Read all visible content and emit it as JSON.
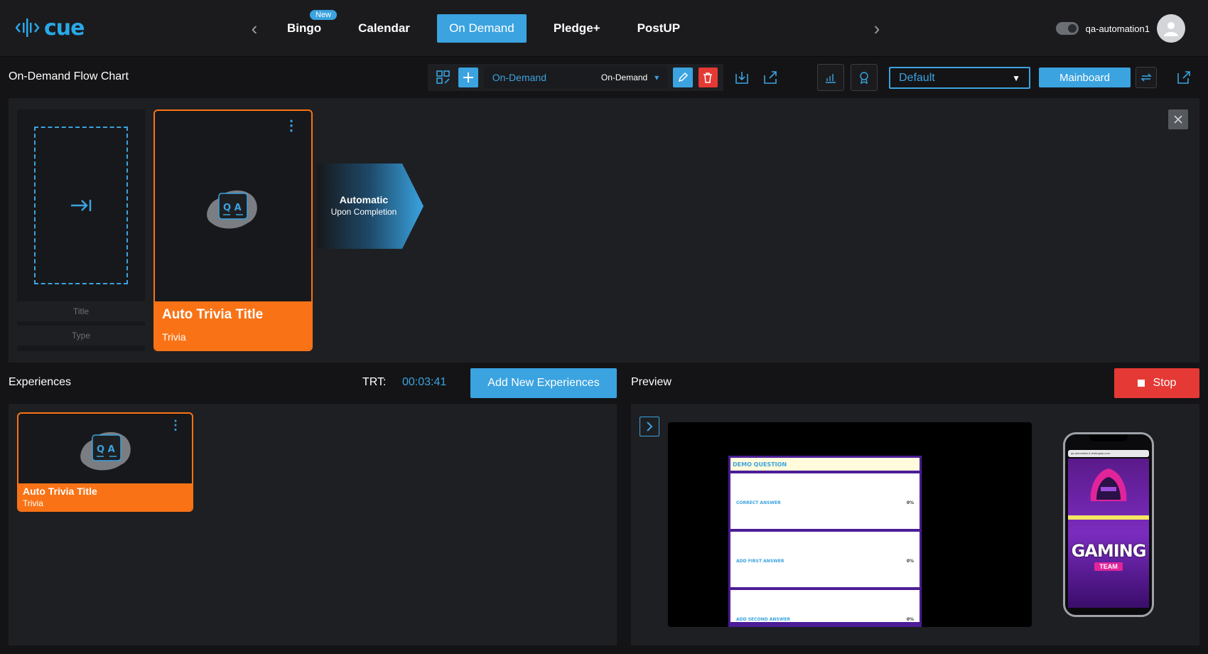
{
  "app": {
    "logo_text": "cue",
    "brand_color": "#3ba3e0",
    "accent_color": "#f97316"
  },
  "nav": {
    "items": [
      {
        "label": "Bingo",
        "badge": "New"
      },
      {
        "label": "Calendar"
      },
      {
        "label": "On Demand",
        "active": true
      },
      {
        "label": "Pledge+"
      },
      {
        "label": "PostUP"
      }
    ],
    "prev_icon": "chevron-left-icon",
    "next_icon": "chevron-right-icon"
  },
  "user": {
    "name": "qa-automation1",
    "theme_toggle_icon": "theme-toggle-icon",
    "avatar_icon": "user-icon"
  },
  "toolbar": {
    "page_title": "On-Demand Flow Chart",
    "playlist_name": "On-Demand",
    "playlist_type": "On-Demand",
    "default_select": "Default",
    "mainboard_label": "Mainboard"
  },
  "flow": {
    "empty_card": {
      "title_placeholder": "Title",
      "type_placeholder": "Type"
    },
    "card": {
      "title": "Auto Trivia Title",
      "type": "Trivia"
    },
    "transition": {
      "line1": "Automatic",
      "line2": "Upon Completion"
    }
  },
  "experiences": {
    "title": "Experiences",
    "trt_label": "TRT:",
    "trt_value": "00:03:41",
    "add_button": "Add New Experiences",
    "items": [
      {
        "title": "Auto Trivia Title",
        "type": "Trivia"
      }
    ]
  },
  "preview": {
    "title": "Preview",
    "stop_button": "Stop",
    "quiz": {
      "question": "DEMO QUESTION",
      "answers": [
        {
          "label": "CORRECT ANSWER",
          "pct": "0%"
        },
        {
          "label": "ADD FIRST ANSWER",
          "pct": "0%"
        },
        {
          "label": "ADD SECOND ANSWER",
          "pct": "0%"
        }
      ]
    },
    "phone": {
      "url": "qa-automation1.testingtop.com",
      "headline": "GAMING",
      "subline": "TEAM"
    }
  }
}
